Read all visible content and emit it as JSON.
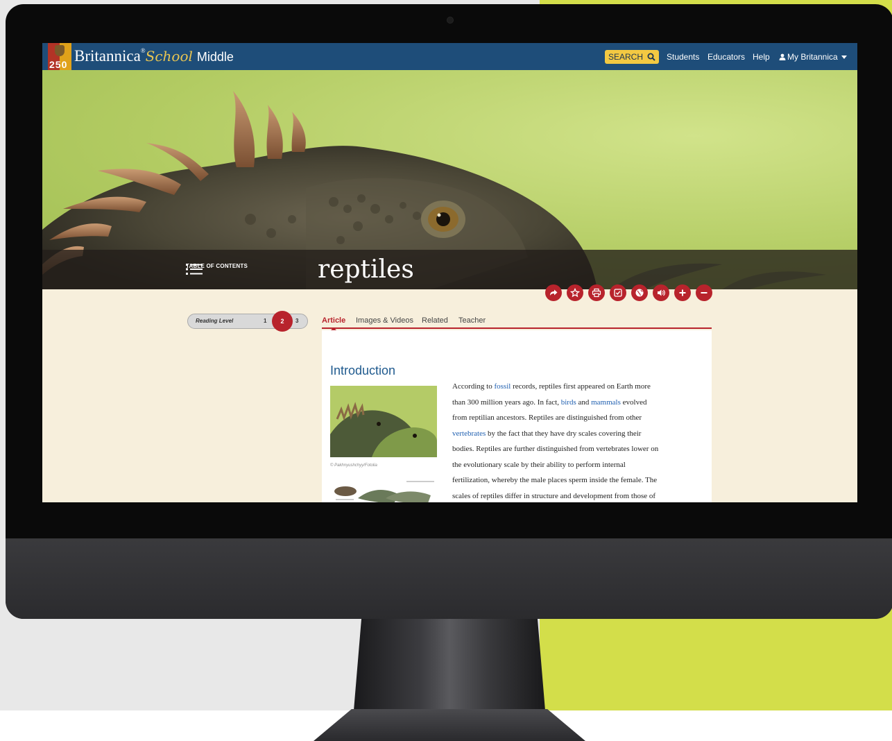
{
  "navbar": {
    "logo_number": "250",
    "brand_name": "Britannica",
    "brand_reg": "®",
    "brand_school": "School",
    "brand_level": "Middle",
    "search_label": "SEARCH",
    "links": [
      "Students",
      "Educators",
      "Help"
    ],
    "account_label": "My Britannica"
  },
  "hero": {
    "toc_label": "TABLE OF CONTENTS",
    "title": "reptiles"
  },
  "tools": {
    "icons": [
      "share-icon",
      "star-icon",
      "print-icon",
      "cite-icon",
      "translate-icon",
      "audio-icon",
      "zoom-in-icon",
      "zoom-out-icon"
    ],
    "color": "#b8232c"
  },
  "reading_level": {
    "label": "Reading Level",
    "levels": [
      "1",
      "2",
      "3"
    ],
    "selected": "2"
  },
  "tabs": [
    "Article",
    "Images & Videos",
    "Related",
    "Teacher"
  ],
  "active_tab": "Article",
  "article": {
    "heading": "Introduction",
    "figure_credit": "© Pakhnyushchyy/Fotolia",
    "lines": [
      [
        "According to ",
        "fossil",
        " records, reptiles first appeared on Earth more"
      ],
      [
        "than 300 million years ago. In fact, ",
        "birds",
        " and ",
        "mammals",
        " evolved"
      ],
      [
        "from reptilian ancestors. Reptiles are distinguished from other"
      ],
      [
        "vertebrates",
        " by the fact that they have dry scales covering their"
      ],
      [
        "bodies. Reptiles are further distinguished from vertebrates lower on"
      ],
      [
        "the evolutionary scale by their ability to perform internal"
      ],
      [
        "fertilization, whereby the male places sperm inside the female. The"
      ],
      [
        "scales of reptiles differ in structure and development from those of"
      ]
    ],
    "links": [
      "fossil",
      "birds",
      "mammals",
      "vertebrates"
    ]
  },
  "colors": {
    "nav": "#1e4d79",
    "accent": "#b8232c",
    "search": "#f3c942",
    "page_bg": "#f7efdc",
    "link": "#1f5fb0",
    "backdrop_lime": "#d3de4a"
  }
}
